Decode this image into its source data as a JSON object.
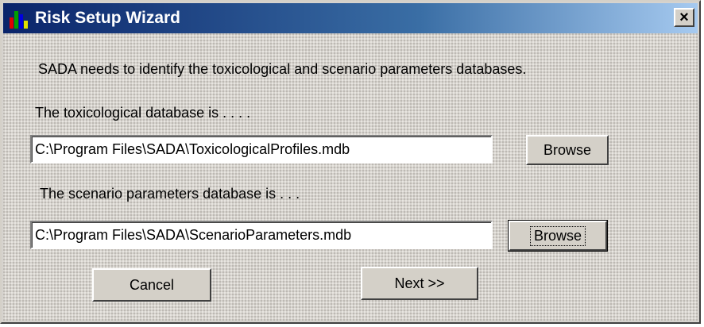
{
  "window": {
    "title": "Risk Setup Wizard",
    "close_glyph": "×",
    "app_icon": "bar-chart-icon"
  },
  "intro_text": "SADA needs to identify the toxicological and scenario parameters databases.",
  "toxicological": {
    "label": "The toxicological database is . . . .",
    "path": "C:\\Program Files\\SADA\\ToxicologicalProfiles.mdb",
    "browse_label": "Browse"
  },
  "scenario": {
    "label": "The scenario parameters database is . . .",
    "path": "C:\\Program Files\\SADA\\ScenarioParameters.mdb",
    "browse_label": "Browse"
  },
  "actions": {
    "cancel_label": "Cancel",
    "next_label": "Next >>"
  }
}
